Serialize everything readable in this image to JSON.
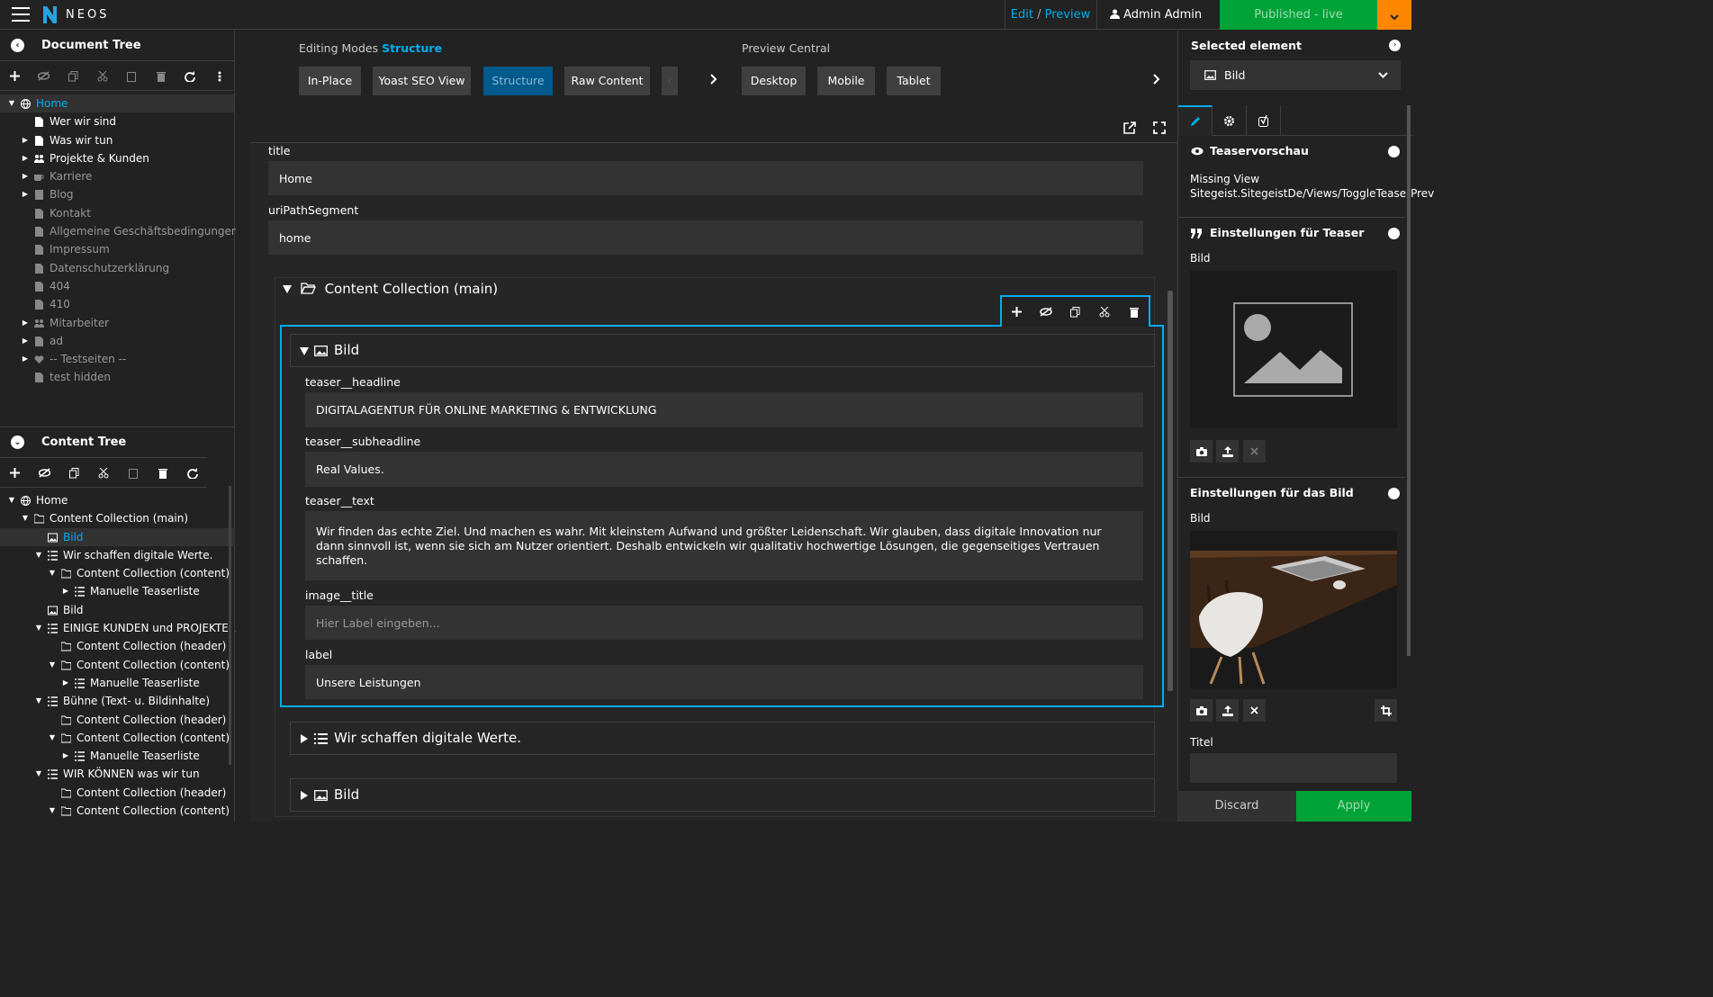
{
  "app": {
    "brand": "NEOS"
  },
  "header": {
    "edit_label": "Edit",
    "separator": "/",
    "preview_label": "Preview",
    "user": "Admin Admin",
    "publish": "Published - live"
  },
  "document_tree": {
    "title": "Document Tree",
    "nodes": [
      {
        "label": "Home"
      },
      {
        "label": "Wer wir sind"
      },
      {
        "label": "Was wir tun"
      },
      {
        "label": "Projekte & Kunden"
      },
      {
        "label": "Karriere"
      },
      {
        "label": "Blog"
      },
      {
        "label": "Kontakt"
      },
      {
        "label": "Allgemeine Geschäftsbedingungen"
      },
      {
        "label": "Impressum"
      },
      {
        "label": "Datenschutzerklärung"
      },
      {
        "label": "404"
      },
      {
        "label": "410"
      },
      {
        "label": "Mitarbeiter"
      },
      {
        "label": "ad"
      },
      {
        "label": "-- Testseiten --"
      },
      {
        "label": "test hidden"
      }
    ]
  },
  "content_tree": {
    "title": "Content Tree",
    "nodes": [
      {
        "label": "Home"
      },
      {
        "label": "Content Collection (main)"
      },
      {
        "label": "Bild"
      },
      {
        "label": "Wir schaffen digitale Werte."
      },
      {
        "label": "Content Collection (content)"
      },
      {
        "label": "Manuelle Teaserliste"
      },
      {
        "label": "Bild"
      },
      {
        "label": "EINIGE KUNDEN und PROJEKTE, A..."
      },
      {
        "label": "Content Collection (header)"
      },
      {
        "label": "Content Collection (content)"
      },
      {
        "label": "Manuelle Teaserliste"
      },
      {
        "label": "Bühne (Text- u. Bildinhalte)"
      },
      {
        "label": "Content Collection (header)"
      },
      {
        "label": "Content Collection (content)"
      },
      {
        "label": "Manuelle Teaserliste"
      },
      {
        "label": "WIR KÖNNEN was wir tun"
      },
      {
        "label": "Content Collection (header)"
      },
      {
        "label": "Content Collection (content)"
      }
    ]
  },
  "editing_modes": {
    "label": "Editing Modes",
    "current": "Structure",
    "buttons": [
      "In-Place",
      "Yoast SEO View",
      "Structure",
      "Raw Content"
    ],
    "overflow_glyph": "‹"
  },
  "preview_central": {
    "label": "Preview Central",
    "buttons": [
      "Desktop",
      "Mobile",
      "Tablet"
    ]
  },
  "document": {
    "fields": [
      {
        "label": "title",
        "value": "Home"
      },
      {
        "label": "uriPathSegment",
        "value": "home"
      }
    ],
    "collection": "Content Collection (main)",
    "selected_node": "Bild",
    "node_fields": {
      "headline_label": "teaser__headline",
      "headline_value": "DIGITALAGENTUR FÜR ONLINE MARKETING & ENTWICKLUNG",
      "subheadline_label": "teaser__subheadline",
      "subheadline_value": "Real Values.",
      "text_label": "teaser__text",
      "text_value": "Wir finden das echte Ziel. Und machen es wahr. Mit kleinstem Aufwand und größter Leidenschaft. Wir glauben, dass digitale Innovation nur dann sinnvoll ist, wenn sie sich am Nutzer orientiert. Deshalb entwickeln wir qualitativ hochwertige Lösungen, die gegenseitiges Vertrauen schaffen.",
      "image_title_label": "image__title",
      "image_title_placeholder": "Hier Label eingeben...",
      "label_label": "label",
      "label_value": "Unsere Leistungen"
    },
    "collapsed_nodes": [
      "Wir schaffen digitale Werte.",
      "Bild"
    ]
  },
  "inspector": {
    "title": "Selected element",
    "selected": "Bild",
    "section1_title": "Teaservorschau",
    "missing_view_line1": "Missing View",
    "missing_view_line2": "Sitegeist.SitegeistDe/Views/ToggleTeaserPrev",
    "section2_title": "Einstellungen für Teaser",
    "teaser_image_label": "Bild",
    "section3_title": "Einstellungen für das Bild",
    "image_label": "Bild",
    "title_label": "Titel",
    "discard": "Discard",
    "apply": "Apply"
  },
  "colors": {
    "accent": "#00adee",
    "publish": "#00a338",
    "dropdown": "#ff8700"
  }
}
